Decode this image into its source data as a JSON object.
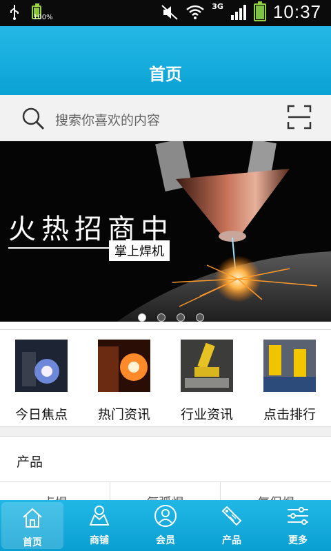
{
  "status_bar": {
    "battery_percent_label": "100%",
    "network_type": "3G",
    "time": "10:37"
  },
  "header": {
    "title": "首页"
  },
  "search": {
    "placeholder": "搜索你喜欢的内容",
    "icon": "search-icon",
    "scan_icon": "scan-icon"
  },
  "banner": {
    "headline": "火热招商中",
    "subtag": "掌上焊机",
    "slide_count": 4,
    "active_slide": 1
  },
  "categories": [
    {
      "label": "今日焦点",
      "icon": "welding-thumb-1"
    },
    {
      "label": "热门资讯",
      "icon": "welding-thumb-2"
    },
    {
      "label": "行业资讯",
      "icon": "robot-arm-thumb-1"
    },
    {
      "label": "点击排行",
      "icon": "robot-arm-thumb-2"
    }
  ],
  "section": {
    "title": "产品"
  },
  "subtabs": [
    {
      "label": "点焊"
    },
    {
      "label": "氩弧焊"
    },
    {
      "label": "气保焊"
    }
  ],
  "bottom_nav": [
    {
      "label": "首页",
      "icon": "home-icon",
      "active": true
    },
    {
      "label": "商铺",
      "icon": "shop-icon",
      "active": false
    },
    {
      "label": "会员",
      "icon": "member-icon",
      "active": false
    },
    {
      "label": "产品",
      "icon": "sale-tag-icon",
      "active": false
    },
    {
      "label": "更多",
      "icon": "more-settings-icon",
      "active": false
    }
  ],
  "colors": {
    "header": "#0aa2d4",
    "statusbar": "#0b0b0b",
    "battery": "#8cc63f"
  }
}
